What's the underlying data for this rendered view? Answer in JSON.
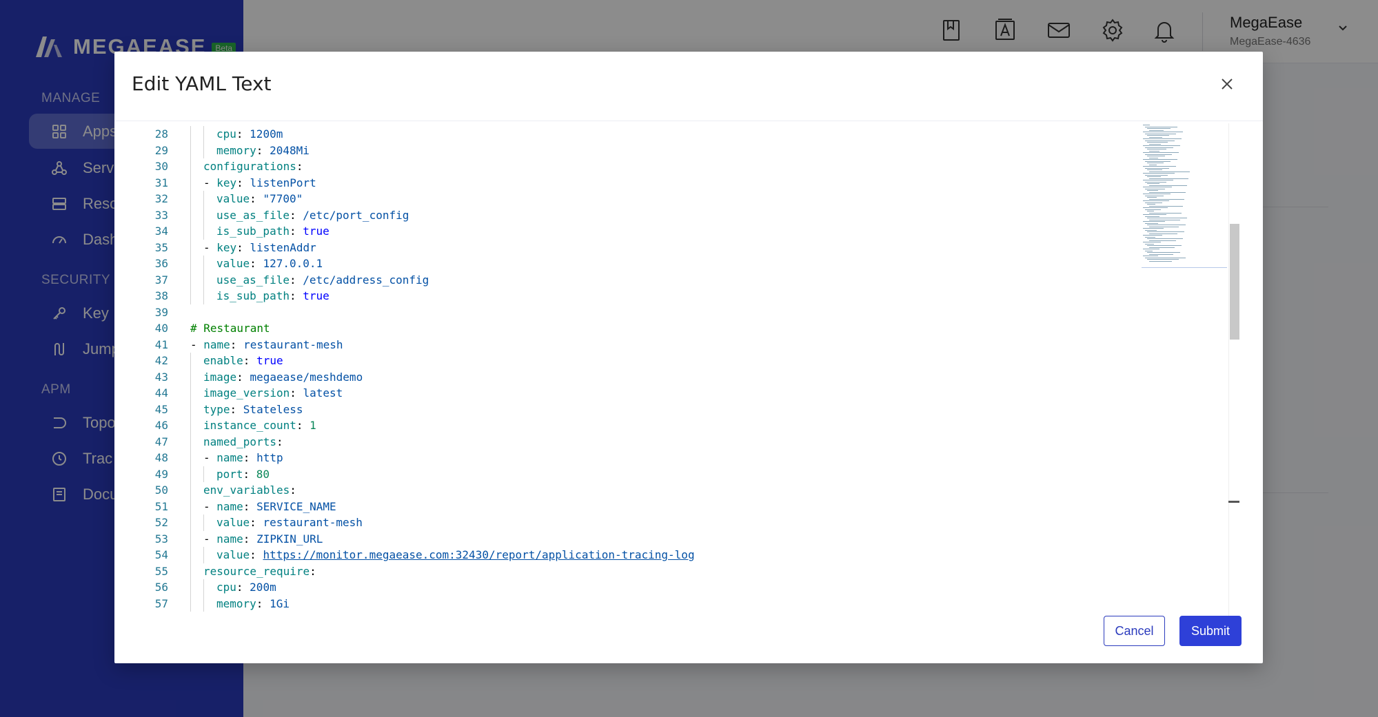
{
  "app": {
    "logo_text": "MEGAEASE",
    "logo_badge": "Beta",
    "sidebar": {
      "sections": [
        {
          "label": "MANAGE",
          "items": [
            {
              "label": "Apps",
              "icon": "apps-grid-icon",
              "active": true
            },
            {
              "label": "Serv",
              "icon": "services-icon",
              "active": false
            },
            {
              "label": "Reso",
              "icon": "resources-icon",
              "active": false
            },
            {
              "label": "Dash",
              "icon": "dashboard-gauge-icon",
              "active": false
            }
          ]
        },
        {
          "label": "SECURITY",
          "items": [
            {
              "label": "Key I",
              "icon": "key-icon",
              "active": false
            },
            {
              "label": "Jump",
              "icon": "jump-server-icon",
              "active": false
            }
          ]
        },
        {
          "label": "APM",
          "items": [
            {
              "label": "Topo",
              "icon": "topology-icon",
              "active": false
            },
            {
              "label": "Trac",
              "icon": "clock-icon",
              "active": false
            },
            {
              "label": "Docu",
              "icon": "document-icon",
              "active": false
            }
          ]
        }
      ]
    },
    "topbar": {
      "icons": [
        "bookmark-icon",
        "text-a-icon",
        "mail-icon",
        "gear-icon",
        "bell-icon"
      ],
      "user_name": "MegaEase",
      "user_id": "MegaEase-4636"
    }
  },
  "modal": {
    "title": "Edit YAML Text",
    "cancel_label": "Cancel",
    "submit_label": "Submit",
    "close_icon": "close-icon",
    "editor": {
      "lines": [
        {
          "n": "28",
          "indent": 2,
          "tokens": [
            [
              "k",
              "cpu"
            ],
            [
              "p",
              ": "
            ],
            [
              "v",
              "1200m"
            ]
          ]
        },
        {
          "n": "29",
          "indent": 2,
          "tokens": [
            [
              "k",
              "memory"
            ],
            [
              "p",
              ": "
            ],
            [
              "v",
              "2048Mi"
            ]
          ]
        },
        {
          "n": "30",
          "indent": 1,
          "tokens": [
            [
              "k",
              "configurations"
            ],
            [
              "p",
              ":"
            ]
          ]
        },
        {
          "n": "31",
          "indent": 1,
          "tokens": [
            [
              "p",
              "- "
            ],
            [
              "k",
              "key"
            ],
            [
              "p",
              ": "
            ],
            [
              "v",
              "listenPort"
            ]
          ]
        },
        {
          "n": "32",
          "indent": 2,
          "tokens": [
            [
              "k",
              "value"
            ],
            [
              "p",
              ": "
            ],
            [
              "v",
              "\"7700\""
            ]
          ]
        },
        {
          "n": "33",
          "indent": 2,
          "tokens": [
            [
              "k",
              "use_as_file"
            ],
            [
              "p",
              ": "
            ],
            [
              "v",
              "/etc/port_config"
            ]
          ]
        },
        {
          "n": "34",
          "indent": 2,
          "tokens": [
            [
              "k",
              "is_sub_path"
            ],
            [
              "p",
              ": "
            ],
            [
              "b",
              "true"
            ]
          ]
        },
        {
          "n": "35",
          "indent": 1,
          "tokens": [
            [
              "p",
              "- "
            ],
            [
              "k",
              "key"
            ],
            [
              "p",
              ": "
            ],
            [
              "v",
              "listenAddr"
            ]
          ]
        },
        {
          "n": "36",
          "indent": 2,
          "tokens": [
            [
              "k",
              "value"
            ],
            [
              "p",
              ": "
            ],
            [
              "v",
              "127.0.0.1"
            ]
          ]
        },
        {
          "n": "37",
          "indent": 2,
          "tokens": [
            [
              "k",
              "use_as_file"
            ],
            [
              "p",
              ": "
            ],
            [
              "v",
              "/etc/address_config"
            ]
          ]
        },
        {
          "n": "38",
          "indent": 2,
          "tokens": [
            [
              "k",
              "is_sub_path"
            ],
            [
              "p",
              ": "
            ],
            [
              "b",
              "true"
            ]
          ]
        },
        {
          "n": "39",
          "indent": 0,
          "tokens": []
        },
        {
          "n": "40",
          "indent": 0,
          "tokens": [
            [
              "c",
              "# Restaurant"
            ]
          ]
        },
        {
          "n": "41",
          "indent": 0,
          "tokens": [
            [
              "p",
              "- "
            ],
            [
              "k",
              "name"
            ],
            [
              "p",
              ": "
            ],
            [
              "v",
              "restaurant-mesh"
            ]
          ]
        },
        {
          "n": "42",
          "indent": 1,
          "tokens": [
            [
              "k",
              "enable"
            ],
            [
              "p",
              ": "
            ],
            [
              "b",
              "true"
            ]
          ]
        },
        {
          "n": "43",
          "indent": 1,
          "tokens": [
            [
              "k",
              "image"
            ],
            [
              "p",
              ": "
            ],
            [
              "v",
              "megaease/meshdemo"
            ]
          ]
        },
        {
          "n": "44",
          "indent": 1,
          "tokens": [
            [
              "k",
              "image_version"
            ],
            [
              "p",
              ": "
            ],
            [
              "v",
              "latest"
            ]
          ]
        },
        {
          "n": "45",
          "indent": 1,
          "tokens": [
            [
              "k",
              "type"
            ],
            [
              "p",
              ": "
            ],
            [
              "v",
              "Stateless"
            ]
          ]
        },
        {
          "n": "46",
          "indent": 1,
          "tokens": [
            [
              "k",
              "instance_count"
            ],
            [
              "p",
              ": "
            ],
            [
              "n",
              "1"
            ]
          ]
        },
        {
          "n": "47",
          "indent": 1,
          "tokens": [
            [
              "k",
              "named_ports"
            ],
            [
              "p",
              ":"
            ]
          ]
        },
        {
          "n": "48",
          "indent": 1,
          "tokens": [
            [
              "p",
              "- "
            ],
            [
              "k",
              "name"
            ],
            [
              "p",
              ": "
            ],
            [
              "v",
              "http"
            ]
          ]
        },
        {
          "n": "49",
          "indent": 2,
          "tokens": [
            [
              "k",
              "port"
            ],
            [
              "p",
              ": "
            ],
            [
              "n",
              "80"
            ]
          ]
        },
        {
          "n": "50",
          "indent": 1,
          "tokens": [
            [
              "k",
              "env_variables"
            ],
            [
              "p",
              ":"
            ]
          ]
        },
        {
          "n": "51",
          "indent": 1,
          "tokens": [
            [
              "p",
              "- "
            ],
            [
              "k",
              "name"
            ],
            [
              "p",
              ": "
            ],
            [
              "v",
              "SERVICE_NAME"
            ]
          ]
        },
        {
          "n": "52",
          "indent": 2,
          "tokens": [
            [
              "k",
              "value"
            ],
            [
              "p",
              ": "
            ],
            [
              "v",
              "restaurant-mesh"
            ]
          ]
        },
        {
          "n": "53",
          "indent": 1,
          "tokens": [
            [
              "p",
              "- "
            ],
            [
              "k",
              "name"
            ],
            [
              "p",
              ": "
            ],
            [
              "v",
              "ZIPKIN_URL"
            ]
          ]
        },
        {
          "n": "54",
          "indent": 2,
          "tokens": [
            [
              "k",
              "value"
            ],
            [
              "p",
              ": "
            ],
            [
              "u",
              "https://monitor.megaease.com:32430/report/application-tracing-log"
            ]
          ]
        },
        {
          "n": "55",
          "indent": 1,
          "tokens": [
            [
              "k",
              "resource_require"
            ],
            [
              "p",
              ":"
            ]
          ]
        },
        {
          "n": "56",
          "indent": 2,
          "tokens": [
            [
              "k",
              "cpu"
            ],
            [
              "p",
              ": "
            ],
            [
              "v",
              "200m"
            ]
          ]
        },
        {
          "n": "57",
          "indent": 2,
          "tokens": [
            [
              "k",
              "memory"
            ],
            [
              "p",
              ": "
            ],
            [
              "v",
              "1Gi"
            ]
          ]
        }
      ]
    }
  }
}
